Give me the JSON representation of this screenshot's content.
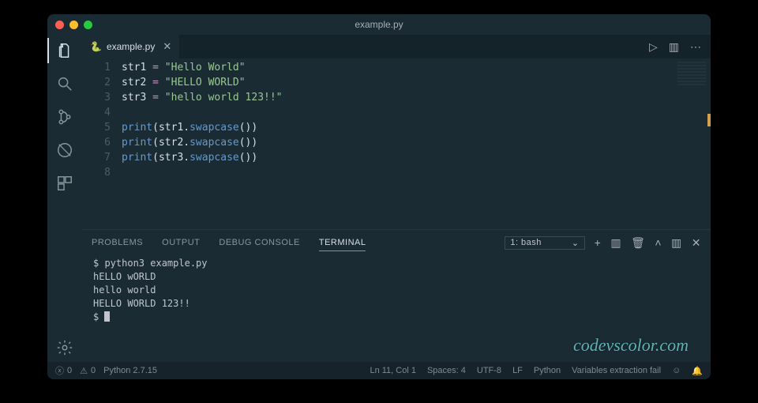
{
  "title": "example.py",
  "tab": {
    "filename": "example.py"
  },
  "code": {
    "lines": [
      {
        "n": 1,
        "var": "str1",
        "op": " = ",
        "str": "\"Hello World\""
      },
      {
        "n": 2,
        "var": "str2",
        "op": " = ",
        "str": "\"HELLO WORLD\""
      },
      {
        "n": 3,
        "var": "str3",
        "op": " = ",
        "str": "\"hello world 123!!\""
      },
      {
        "n": 4,
        "blank": true
      },
      {
        "n": 5,
        "fn": "print",
        "arg_var": "str1",
        "prop": "swapcase"
      },
      {
        "n": 6,
        "fn": "print",
        "arg_var": "str2",
        "prop": "swapcase"
      },
      {
        "n": 7,
        "fn": "print",
        "arg_var": "str3",
        "prop": "swapcase"
      },
      {
        "n": 8,
        "blank": true
      }
    ]
  },
  "panel": {
    "tabs": {
      "problems": "PROBLEMS",
      "output": "OUTPUT",
      "debug": "DEBUG CONSOLE",
      "terminal": "TERMINAL"
    },
    "terminal_selector": "1: bash",
    "terminal_lines": [
      "$ python3 example.py",
      "hELLO wORLD",
      "hello world",
      "HELLO WORLD 123!!",
      "$ "
    ]
  },
  "status": {
    "errors": "0",
    "warnings": "0",
    "python_version": "Python 2.7.15",
    "cursor": "Ln 11, Col 1",
    "spaces": "Spaces: 4",
    "encoding": "UTF-8",
    "eol": "LF",
    "lang": "Python",
    "ext": "Variables extraction fail"
  },
  "watermark": "codevscolor.com"
}
